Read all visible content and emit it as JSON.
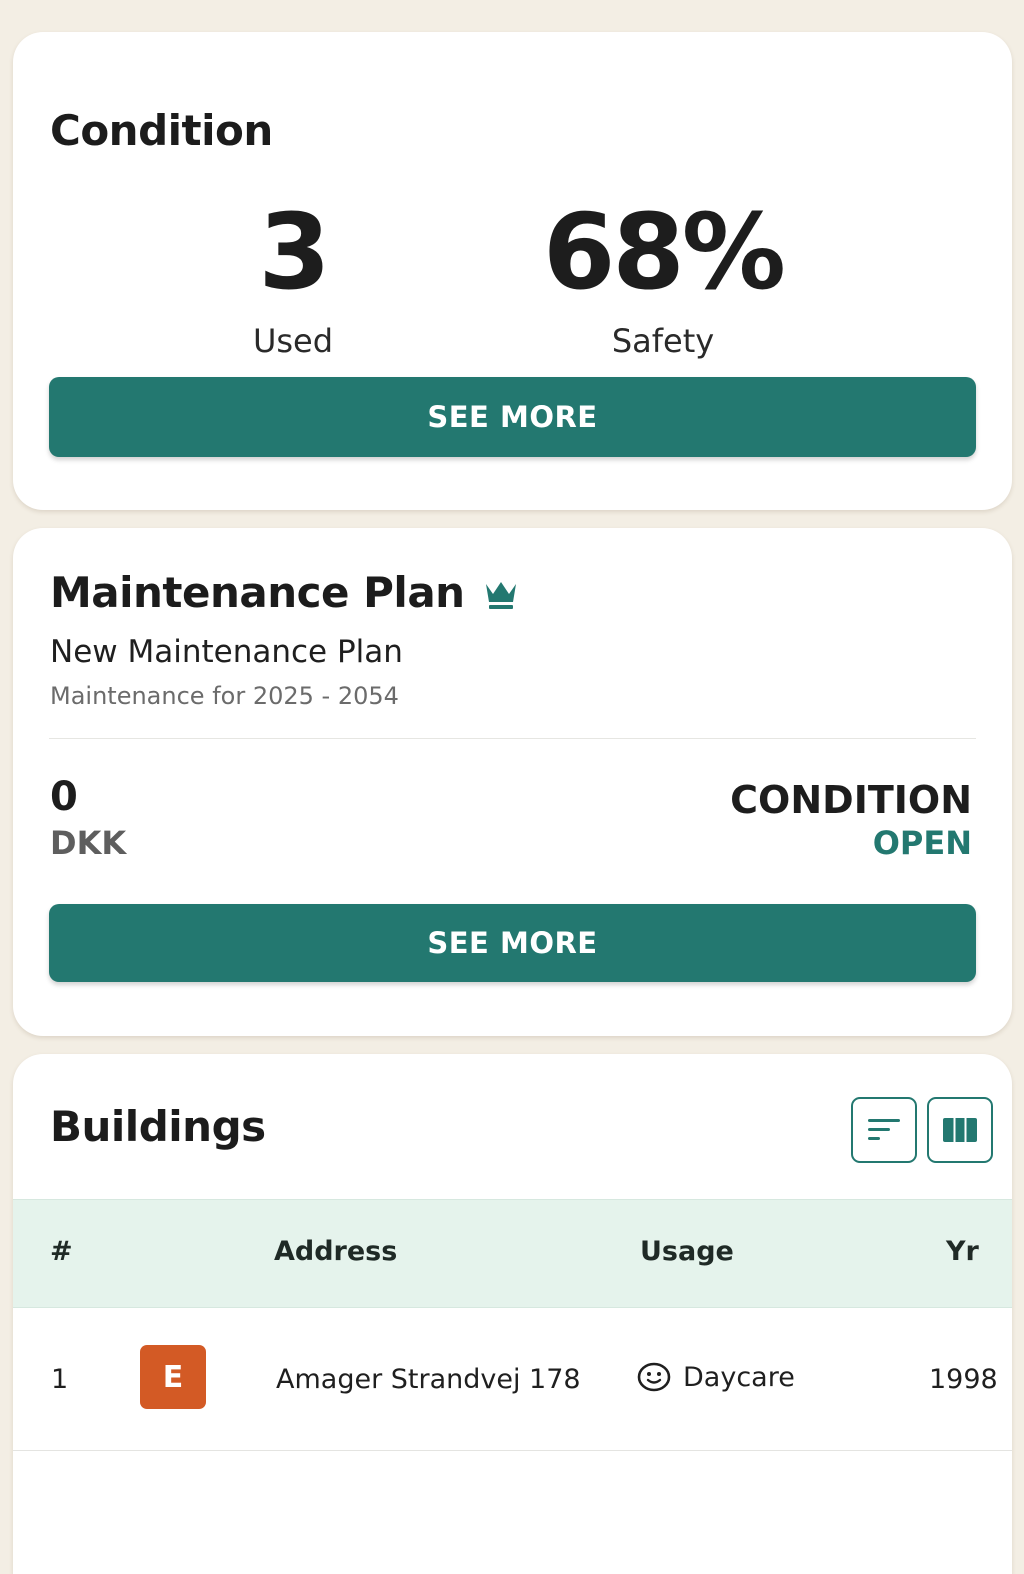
{
  "condition": {
    "title": "Condition",
    "used_value": "3",
    "used_label": "Used",
    "safety_value": "68%",
    "safety_label": "Safety",
    "button_label": "SEE MORE"
  },
  "maintenance": {
    "title": "Maintenance Plan",
    "premium_icon": "crown-icon",
    "plan_name": "New Maintenance Plan",
    "plan_period": "Maintenance for 2025 - 2054",
    "amount": "0",
    "currency": "DKK",
    "condition_label": "CONDITION",
    "condition_status": "OPEN",
    "button_label": "SEE MORE"
  },
  "buildings": {
    "title": "Buildings",
    "toolbar_icons": [
      "sort-icon",
      "columns-icon"
    ],
    "columns": [
      "#",
      "Address",
      "Usage",
      "Yr"
    ],
    "rows": [
      {
        "number": "1",
        "energy_label": "E",
        "address": "Amager Strandvej 178",
        "usage_icon": "smiley-icon",
        "usage": "Daycare",
        "year": "1998"
      }
    ]
  },
  "colors": {
    "accent": "#237870",
    "background": "#f3eee4",
    "table_header": "#e5f3ec",
    "energy_e": "#d35a25"
  }
}
